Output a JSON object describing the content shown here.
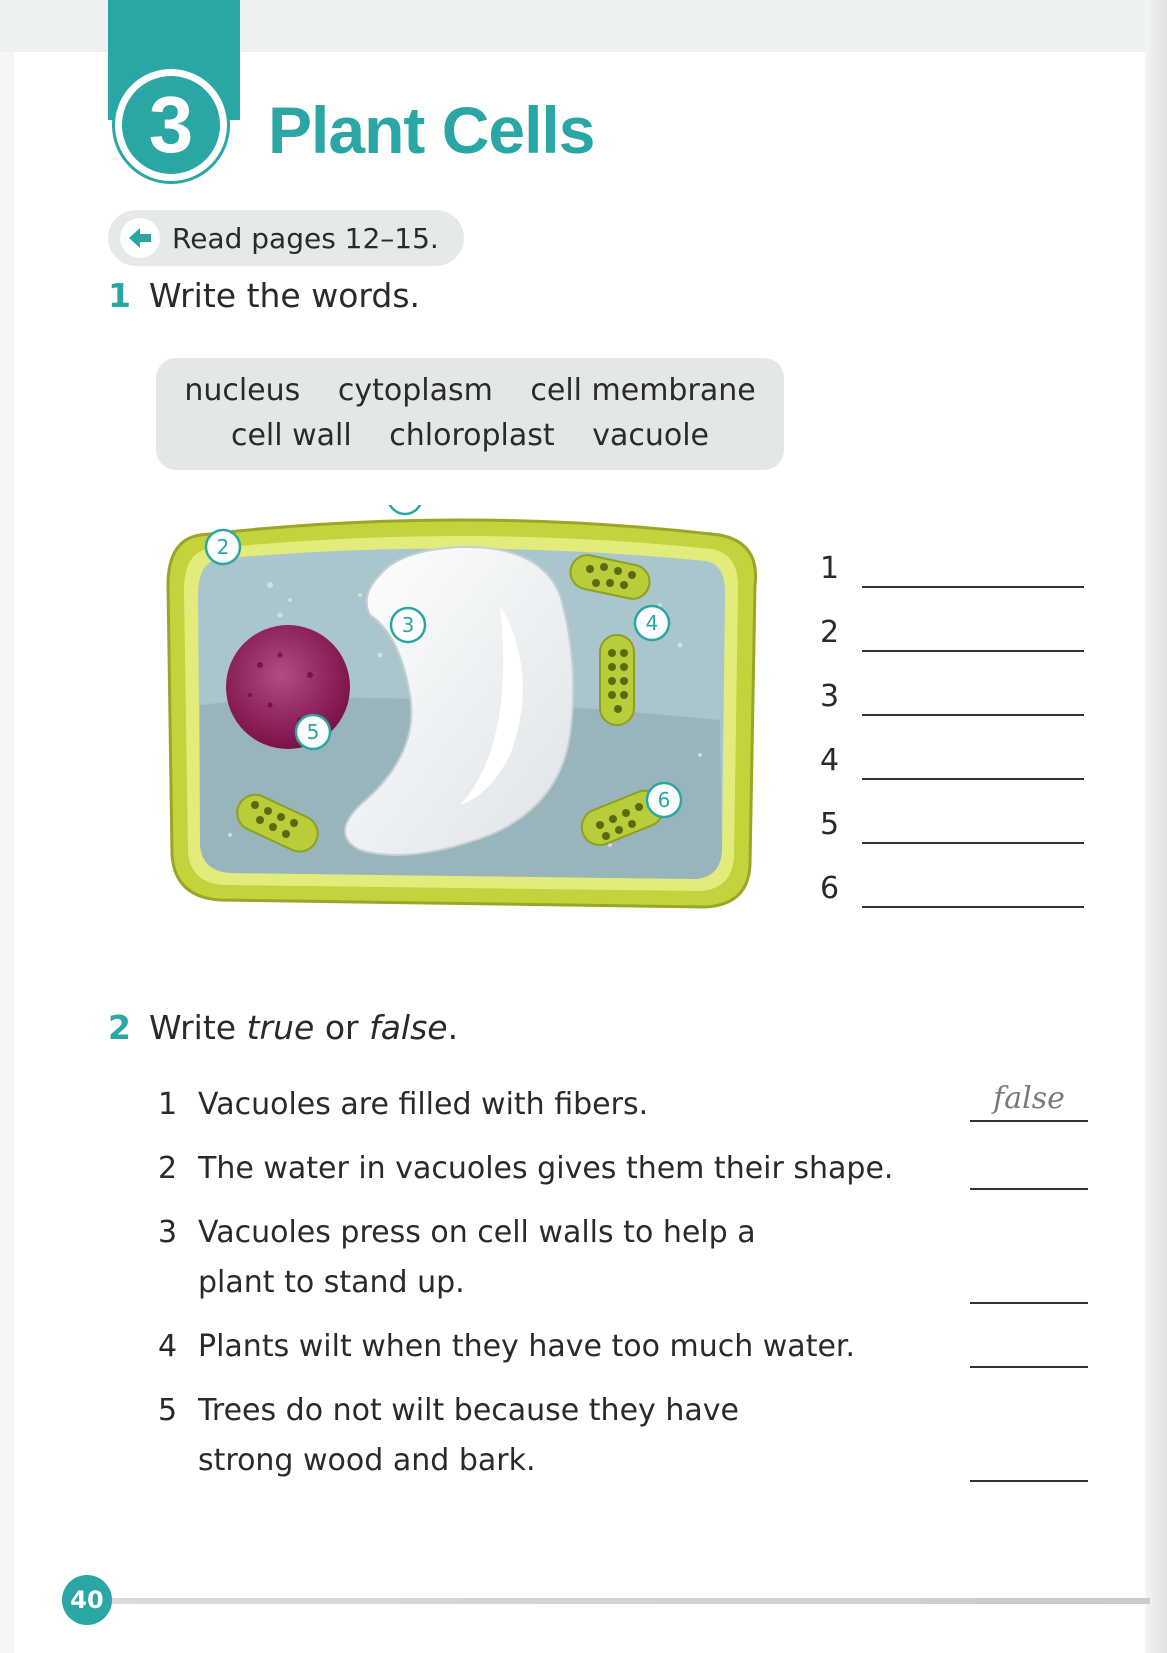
{
  "header": {
    "chapter_number": "3",
    "title": "Plant Cells"
  },
  "read_note": {
    "icon": "back-arrow-icon",
    "text": "Read pages 12–15."
  },
  "exercise1": {
    "number": "1",
    "instruction": "Write the words.",
    "word_bank": {
      "row1": [
        "nucleus",
        "cytoplasm",
        "cell membrane"
      ],
      "row2": [
        "cell wall",
        "chloroplast",
        "vacuole"
      ]
    },
    "diagram_labels": [
      "1",
      "2",
      "3",
      "4",
      "5",
      "6"
    ],
    "answer_numbers": [
      "1",
      "2",
      "3",
      "4",
      "5",
      "6"
    ]
  },
  "exercise2": {
    "number": "2",
    "instruction_pre": "Write ",
    "instruction_true": "true",
    "instruction_or": " or ",
    "instruction_false": "false",
    "instruction_post": ".",
    "items": [
      {
        "n": "1",
        "text": "Vacuoles are filled with fibers.",
        "answer": "false"
      },
      {
        "n": "2",
        "text": "The water in vacuoles gives them their shape.",
        "answer": ""
      },
      {
        "n": "3",
        "text": "Vacuoles press on cell walls to help a plant to stand up.",
        "answer": ""
      },
      {
        "n": "4",
        "text": "Plants wilt when they have too much water.",
        "answer": ""
      },
      {
        "n": "5",
        "text": "Trees do not wilt because they have strong wood and bark.",
        "answer": ""
      }
    ]
  },
  "footer": {
    "page_number": "40"
  },
  "colors": {
    "accent": "#2aa6a4",
    "cell_wall": "#c4d23b",
    "cytoplasm": "#a9c6cc",
    "nucleus": "#8e1d56",
    "chloroplast": "#b9cc3a"
  }
}
